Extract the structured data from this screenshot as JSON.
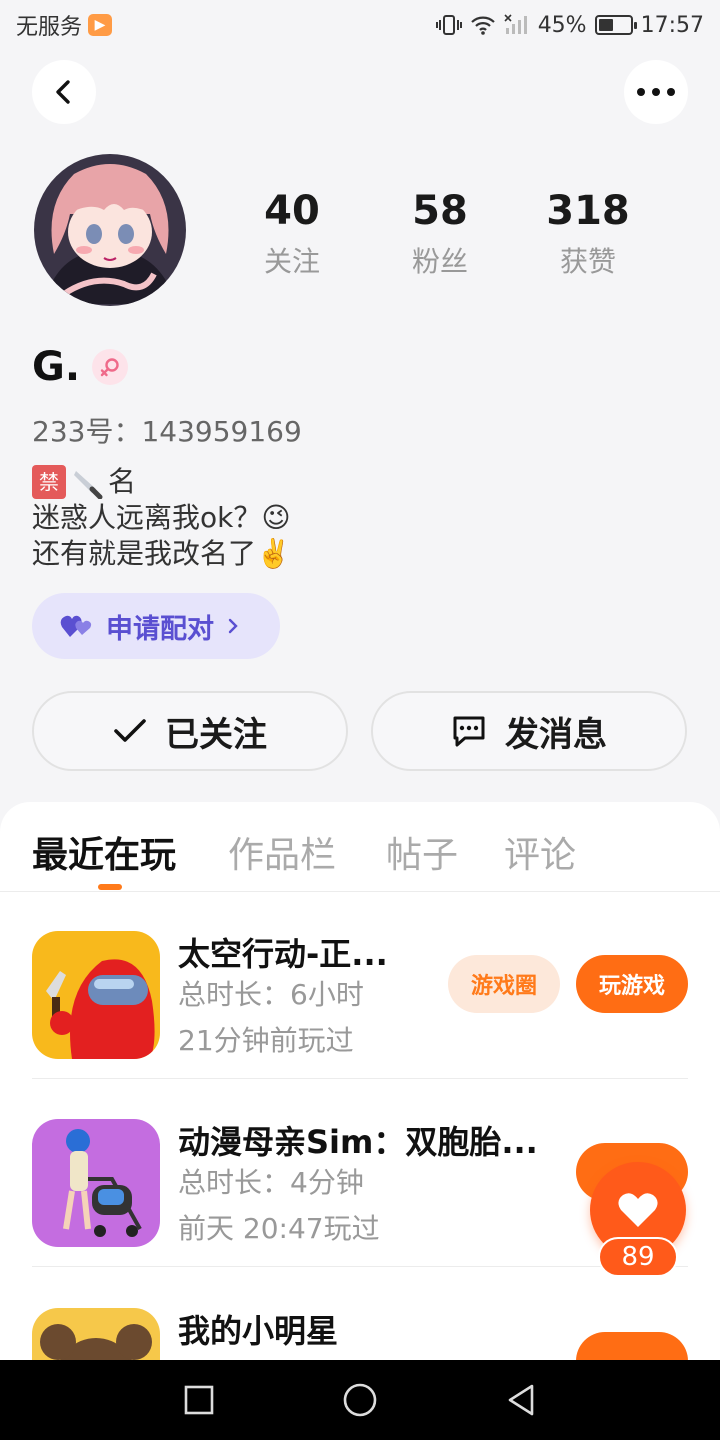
{
  "status_bar": {
    "carrier": "无服务",
    "battery": "45%",
    "battery_level": 0.45,
    "time": "17:57"
  },
  "profile": {
    "stats": [
      {
        "value": "40",
        "label": "关注"
      },
      {
        "value": "58",
        "label": "粉丝"
      },
      {
        "value": "318",
        "label": "获赞"
      }
    ],
    "username": "G.",
    "uid": "233号：143959169",
    "bio": {
      "line1": "名",
      "line1_tag": "禁",
      "line2": "迷惑人远离我ok？😉",
      "line3": "还有就是我改名了✌️"
    },
    "pair_label": "申请配对",
    "follow_label": "已关注",
    "message_label": "发消息"
  },
  "tabs": [
    "最近在玩",
    "作品栏",
    "帖子",
    "评论"
  ],
  "games": [
    {
      "title": "太空行动-正...",
      "duration": "总时长：6小时",
      "last_played": "21分钟前玩过",
      "circle_label": "游戏圈",
      "play_label": "玩游戏"
    },
    {
      "title": "动漫母亲Sim：双胞胎...",
      "duration": "总时长：4分钟",
      "last_played": "前天 20:47玩过"
    },
    {
      "title": "我的小明星"
    }
  ],
  "float_like": {
    "count": "89"
  },
  "colors": {
    "accent": "#ff6d14",
    "pair_bg": "#e6e4fb",
    "pair_text": "#5a4fd1"
  }
}
